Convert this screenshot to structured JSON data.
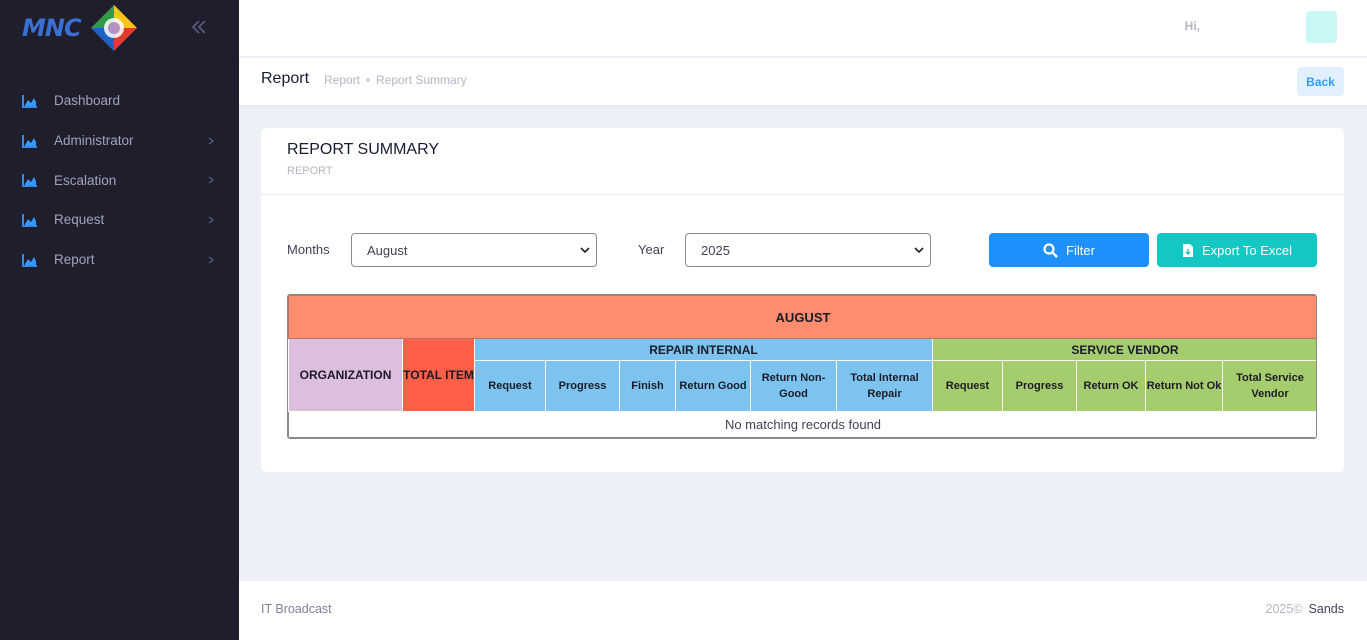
{
  "brand": {
    "logo_text": "MNC"
  },
  "sidebar": {
    "items": [
      {
        "label": "Dashboard",
        "has_submenu": false
      },
      {
        "label": "Administrator",
        "has_submenu": true
      },
      {
        "label": "Escalation",
        "has_submenu": true
      },
      {
        "label": "Request",
        "has_submenu": true
      },
      {
        "label": "Report",
        "has_submenu": true
      }
    ]
  },
  "header": {
    "greeting": "Hi, "
  },
  "subheader": {
    "title": "Report",
    "breadcrumbs": [
      "Report",
      "Report Summary"
    ],
    "back_label": "Back"
  },
  "card": {
    "title": "REPORT SUMMARY",
    "subtitle": "REPORT"
  },
  "filters": {
    "months_label": "Months",
    "months_value": "August",
    "year_label": "Year",
    "year_value": "2025",
    "filter_label": "Filter",
    "export_label": "Export To Excel"
  },
  "table": {
    "month_header": "AUGUST",
    "organization": "ORGANIZATION",
    "total_item": "TOTAL ITEM",
    "repair_group": "REPAIR INTERNAL",
    "vendor_group": "SERVICE VENDOR",
    "repair_cols": [
      "Request",
      "Progress",
      "Finish",
      "Return Good",
      "Return Non-Good",
      "Total Internal Repair"
    ],
    "vendor_cols": [
      "Request",
      "Progress",
      "Return OK",
      "Return Not Ok",
      "Total Service Vendor"
    ],
    "empty_message": "No matching records found"
  },
  "footer": {
    "left": "IT Broadcast",
    "year": "2025©",
    "brand": "Sands"
  },
  "colors": {
    "sidebar_bg": "#1e1e2d",
    "accent_blue": "#1e90ff",
    "accent_teal": "#13c7c2",
    "month_bg": "#ff8c6e",
    "org_bg": "#dcbfdc",
    "total_bg": "#ff5f48",
    "repair_bg": "#7cc4ef",
    "vendor_bg": "#a6cd6d"
  }
}
